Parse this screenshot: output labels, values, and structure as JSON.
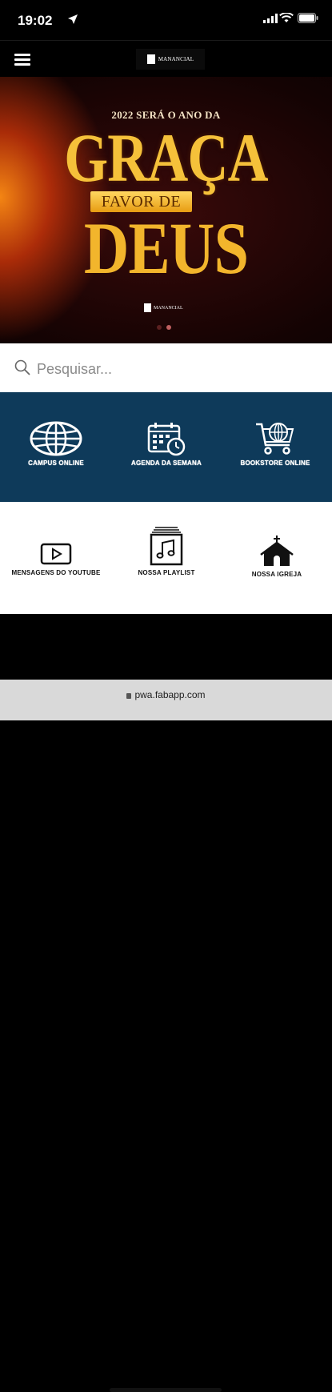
{
  "status_bar": {
    "time": "19:02"
  },
  "header": {
    "logo_text": "MANANCIAL"
  },
  "hero": {
    "line1": "2022 SERÁ O ANO DA",
    "word1": "GRAÇA",
    "band_text": "FAVOR DE",
    "word2": "DEUS",
    "logo_text": "MANANCIAL",
    "slides": 2,
    "active_slide": 2
  },
  "search": {
    "placeholder": "Pesquisar..."
  },
  "tiles_row1": [
    {
      "label": "CAMPUS ONLINE",
      "icon": "globe-icon"
    },
    {
      "label": "AGENDA DA SEMANA",
      "icon": "calendar-clock-icon"
    },
    {
      "label": "BOOKSTORE ONLINE",
      "icon": "cart-globe-icon"
    }
  ],
  "tiles_row2": [
    {
      "label": "MENSAGENS DO YOUTUBE",
      "icon": "play-icon"
    },
    {
      "label": "NOSSA PLAYLIST",
      "icon": "music-stack-icon"
    },
    {
      "label": "NOSSA IGREJA",
      "icon": "church-icon"
    }
  ],
  "url_bar": {
    "url": "pwa.fabapp.com"
  },
  "colors": {
    "band1_bg": "#0e3a5a",
    "hero_gold": "#f5c13a"
  }
}
